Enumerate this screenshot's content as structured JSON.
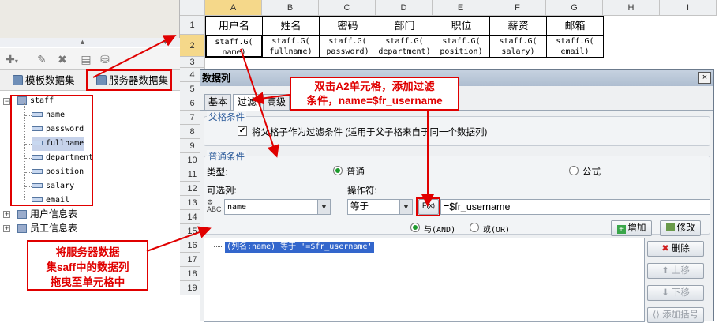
{
  "toolbar": {
    "add_icon": "add-dropdown-icon",
    "edit_icon": "pencil-icon",
    "delete_icon": "delete-x-icon",
    "copy_icon": "copy-icon",
    "db_icon": "database-icon"
  },
  "dataset_tabs": {
    "template": "模板数据集",
    "server": "服务器数据集"
  },
  "tree": {
    "root": "staff",
    "fields": [
      "name",
      "password",
      "fullname",
      "department",
      "position",
      "salary",
      "email"
    ],
    "other_nodes": [
      "用户信息表",
      "员工信息表"
    ]
  },
  "annotations": {
    "left_note": "将服务器数据\n集saff中的数据列\n拖曳至单元格中",
    "top_note": "双击A2单元格，添加过滤\n条件，name=$fr_username"
  },
  "sheet": {
    "columns": [
      "A",
      "B",
      "C",
      "D",
      "E",
      "F",
      "G",
      "H",
      "I"
    ],
    "rows": [
      "1",
      "2",
      "3",
      "4",
      "5",
      "6",
      "7",
      "8",
      "9",
      "10",
      "11",
      "12",
      "13",
      "14",
      "15",
      "16",
      "17",
      "18",
      "19"
    ],
    "headers": [
      "用户名",
      "姓名",
      "密码",
      "部门",
      "职位",
      "薪资",
      "邮箱"
    ],
    "formulas": [
      [
        "staff.G(",
        "name)"
      ],
      [
        "staff.G(",
        "fullname)"
      ],
      [
        "staff.G(",
        "password)"
      ],
      [
        "staff.G(",
        "department)"
      ],
      [
        "staff.G(",
        "position)"
      ],
      [
        "staff.G(",
        "salary)"
      ],
      [
        "staff.G(",
        "email)"
      ]
    ]
  },
  "dialog": {
    "title": "数据列",
    "close": "×",
    "tabs": [
      "基本",
      "过滤",
      "高级"
    ],
    "parent_group": "父格条件",
    "parent_checkbox": "将父格子作为过滤条件 (适用于父子格来自于同一个数据列)",
    "normal_group": "普通条件",
    "type_label": "类型:",
    "type_normal": "普通",
    "type_formula": "公式",
    "column_label": "可选列:",
    "operator_label": "操作符:",
    "column_value": "name",
    "operator_value": "等于",
    "fx_label": "F(x)",
    "value_input": "=$fr_username",
    "and_label": "与(AND)",
    "or_label": "或(OR)",
    "add_button": "增加",
    "modify_button": "修改",
    "delete_button": "删除",
    "up_button": "上移",
    "down_button": "下移",
    "paren_button": "添加括号",
    "condition_item": "(列名:name) 等于 '=$fr_username'",
    "accent": "#e00000"
  }
}
